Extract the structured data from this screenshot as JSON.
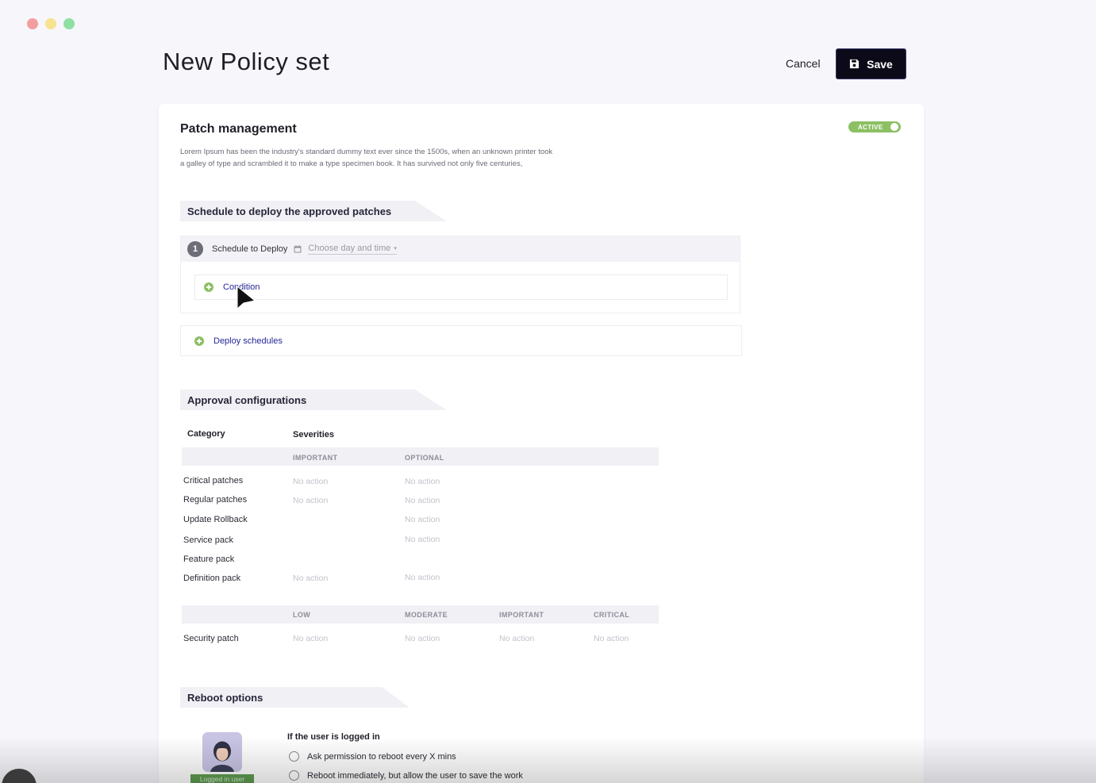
{
  "window": {
    "controls": [
      "close",
      "minimize",
      "maximize"
    ]
  },
  "header": {
    "title": "New Policy set",
    "cancel_label": "Cancel",
    "save_label": "Save"
  },
  "policy": {
    "title": "Patch management",
    "status_label": "ACTIVE",
    "description_line1": "Lorem Ipsum has been the industry's standard dummy text ever since the 1500s, when an unknown printer took",
    "description_line2": "a galley of type and scrambled it to make a type specimen book. It has survived not only five centuries,"
  },
  "schedule": {
    "section_title": "Schedule to deploy the approved patches",
    "step_number": "1",
    "step_label": "Schedule to Deploy",
    "date_placeholder": "Choose day and time",
    "condition_label": "Condition",
    "deploy_schedules_label": "Deploy schedules"
  },
  "approval": {
    "section_title": "Approval configurations",
    "category_header": "Category",
    "severities_header": "Severities",
    "table1": {
      "columns": [
        "IMPORTANT",
        "OPTIONAL"
      ],
      "rows": [
        {
          "label": "Critical patches",
          "cells": [
            "No action",
            "No action"
          ]
        },
        {
          "label": "Regular patches",
          "cells": [
            "No action",
            "No action"
          ]
        },
        {
          "label": "Update Rollback",
          "cells": [
            "",
            "No action"
          ]
        },
        {
          "label": "Service pack",
          "cells": [
            "",
            "No action"
          ]
        },
        {
          "label": "Feature pack",
          "cells": [
            "",
            ""
          ]
        },
        {
          "label": "Definition pack",
          "cells": [
            "No action",
            "No action"
          ]
        }
      ]
    },
    "table2": {
      "columns": [
        "LOW",
        "MODERATE",
        "IMPORTANT",
        "CRITICAL"
      ],
      "rows": [
        {
          "label": "Security patch",
          "cells": [
            "No action",
            "No action",
            "No action",
            "No action"
          ]
        }
      ]
    }
  },
  "reboot": {
    "section_title": "Reboot options",
    "badge_label": "Logged in user",
    "group_title": "If the user is logged in",
    "options": [
      "Ask permission to reboot every X mins",
      "Reboot immediately, but allow the user to save the work"
    ]
  },
  "colors": {
    "accent_green": "#8cc063",
    "link_blue": "#26269a",
    "save_bg": "#0c0a18"
  }
}
